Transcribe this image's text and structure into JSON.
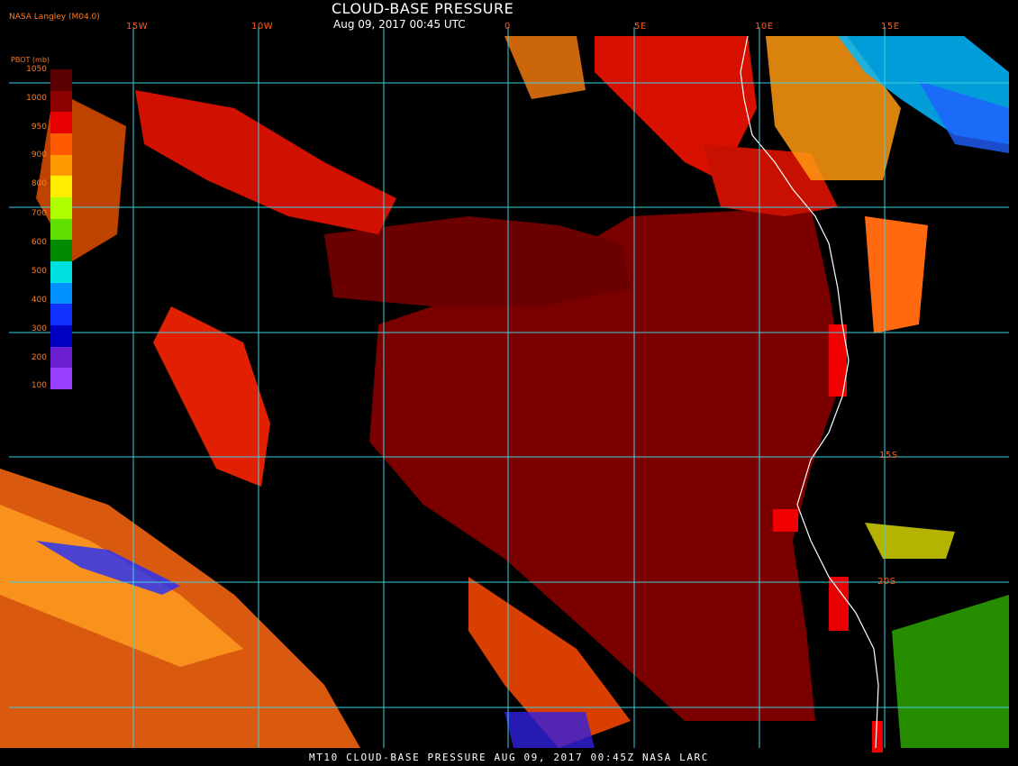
{
  "header": {
    "title": "CLOUD-BASE PRESSURE",
    "subtitle": "Aug 09, 2017 00:45 UTC",
    "agency": "NASA Langley  (M04.0)"
  },
  "footer": {
    "text": "MT10  CLOUD-BASE PRESSURE   AUG 09, 2017 00:45Z   NASA LARC"
  },
  "legend": {
    "title": "PBOT (mb)",
    "ticks": [
      "1050",
      "1000",
      "950",
      "900",
      "800",
      "700",
      "600",
      "500",
      "400",
      "300",
      "200",
      "100"
    ],
    "colors": [
      "#5a0000",
      "#8b0000",
      "#e60000",
      "#ff5a00",
      "#ff9a00",
      "#ffee00",
      "#b0ff00",
      "#60e000",
      "#008a00",
      "#00e0e0",
      "#0090ff",
      "#1030ff",
      "#0000c0",
      "#6a20d0",
      "#9a40ff"
    ]
  },
  "map": {
    "lon_labels": [
      "15W",
      "10W",
      "0",
      "5E",
      "10E",
      "15E"
    ],
    "lat_labels": [
      "15S",
      "20S"
    ],
    "grid_color": "#40d0e0",
    "coast_color": "#ffffff"
  }
}
